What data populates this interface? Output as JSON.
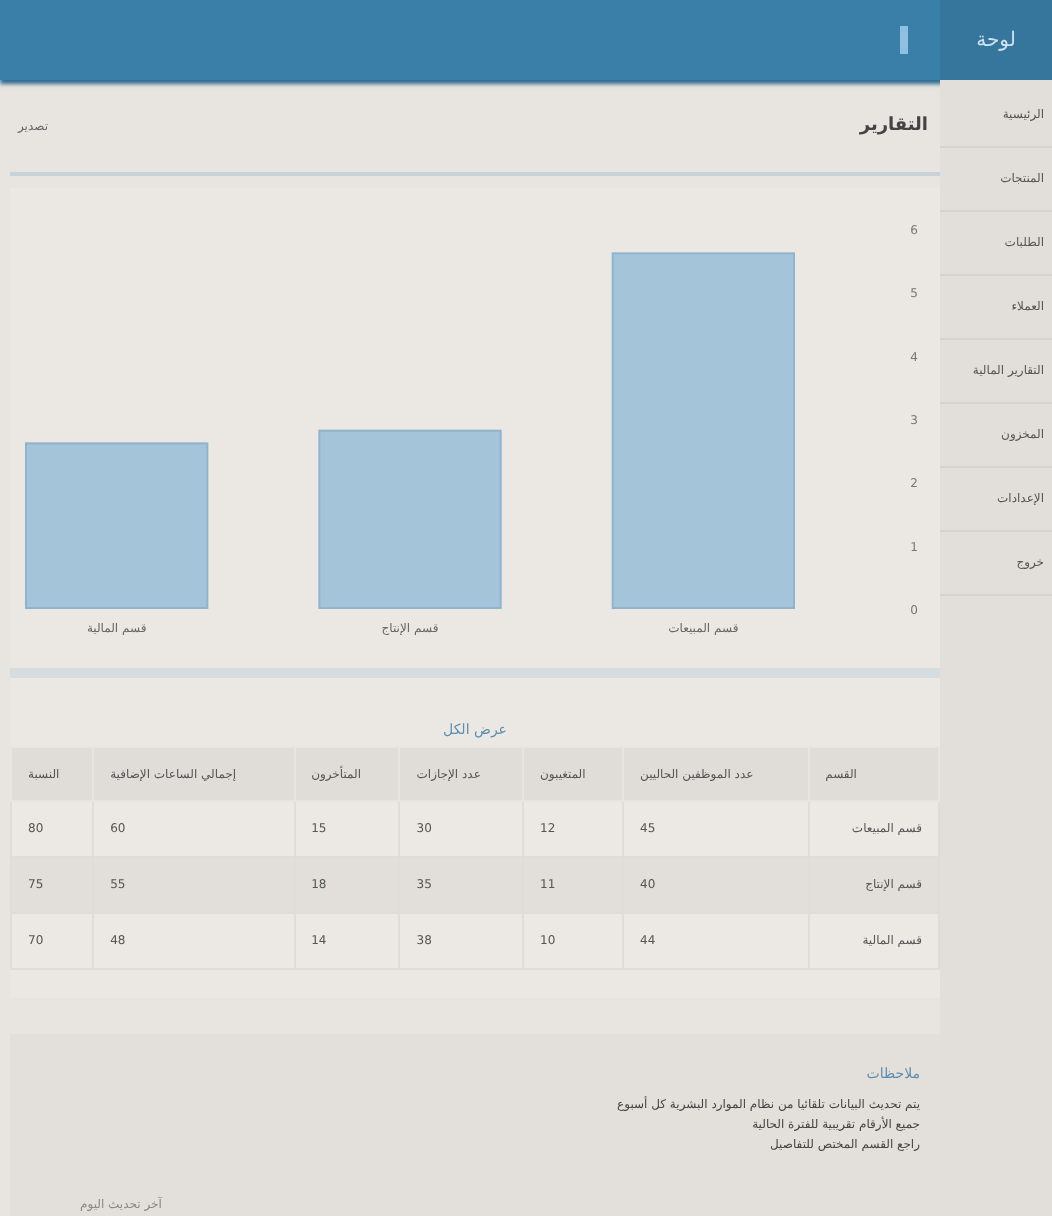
{
  "header": {
    "title": "لوحة"
  },
  "sidebar": {
    "items": [
      {
        "label": "الرئيسية",
        "selected": false
      },
      {
        "label": "المنتجات",
        "selected": false
      },
      {
        "label": "الطلبات",
        "selected": false
      },
      {
        "label": "العملاء",
        "selected": false
      },
      {
        "label": "التقارير المالية",
        "selected": false
      },
      {
        "label": "المخزون",
        "selected": false
      },
      {
        "label": "الإعدادات",
        "selected": false
      },
      {
        "label": "خروج",
        "selected": false
      }
    ]
  },
  "page": {
    "title": "التقارير",
    "export": "تصدير"
  },
  "chart": {
    "chart_data": {
      "type": "bar",
      "categories": [
        "قسم المالية",
        "قسم الإنتاج",
        "قسم المبيعات"
      ],
      "values": [
        2.6,
        2.8,
        5.6
      ],
      "ylim": [
        0,
        6
      ],
      "yticks": [
        0,
        1,
        2,
        3,
        4,
        5,
        6
      ]
    }
  },
  "table": {
    "link": "عرض الكل",
    "columns": [
      "القسم",
      "عدد الموظفين الحاليين",
      "المتغيبون",
      "عدد الإجازات",
      "المتأخرون",
      "إجمالي الساعات الإضافية",
      "النسبة"
    ],
    "rows": [
      [
        "قسم المبيعات",
        "45",
        "12",
        "30",
        "15",
        "60",
        "80"
      ],
      [
        "قسم الإنتاج",
        "40",
        "11",
        "35",
        "18",
        "55",
        "75"
      ],
      [
        "قسم المالية",
        "44",
        "10",
        "38",
        "14",
        "48",
        "70"
      ]
    ]
  },
  "notes": {
    "title": "ملاحظات",
    "lines": [
      "يتم تحديث البيانات تلقائيا من نظام الموارد البشرية كل أسبوع",
      "جميع الأرقام تقريبية للفترة الحالية",
      "راجع القسم المختص للتفاصيل"
    ]
  },
  "footer": {
    "text": "آخر تحديث اليوم"
  }
}
